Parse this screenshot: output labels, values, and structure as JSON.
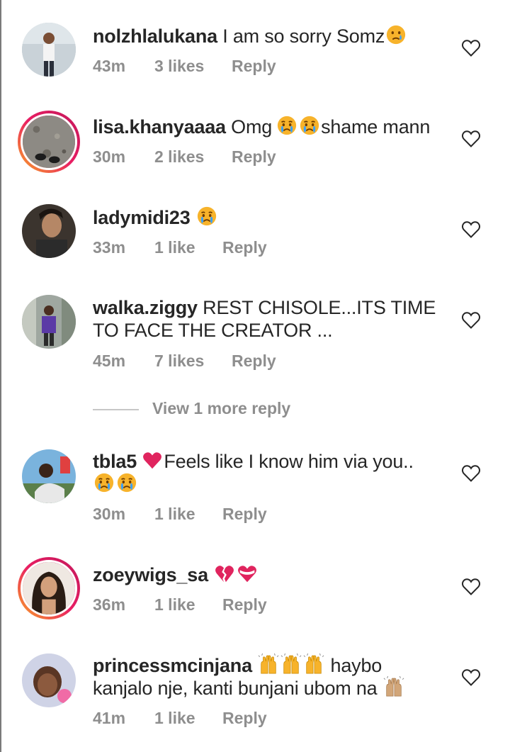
{
  "comments": [
    {
      "username": "nolzhlalukana",
      "text": "I am so sorry Somz",
      "time": "43m",
      "likes": "3 likes",
      "reply": "Reply",
      "story_ring": false
    },
    {
      "username": "lisa.khanyaaaa",
      "text_before": "Omg",
      "text": "shame mann",
      "time": "30m",
      "likes": "2 likes",
      "reply": "Reply",
      "story_ring": true
    },
    {
      "username": "ladymidi23",
      "time": "33m",
      "likes": "1 like",
      "reply": "Reply",
      "story_ring": false
    },
    {
      "username": "walka.ziggy",
      "text_line1": "REST CHISOLE...ITS TIME",
      "text_line2": "TO FACE THE CREATOR ...",
      "time": "45m",
      "likes": "7 likes",
      "reply": "Reply",
      "story_ring": false,
      "view_more": "View 1 more reply"
    },
    {
      "username": "tbla5",
      "text": "Feels like I know him via you..",
      "time": "30m",
      "likes": "1 like",
      "reply": "Reply",
      "story_ring": false
    },
    {
      "username": "zoeywigs_sa",
      "time": "36m",
      "likes": "1 like",
      "reply": "Reply",
      "story_ring": true
    },
    {
      "username": "princessmcinjana",
      "text_line1": "haybo",
      "text_line2": "kanjalo nje, kanti bunjani ubom na",
      "time": "41m",
      "likes": "1 like",
      "reply": "Reply",
      "story_ring": false
    }
  ],
  "icons": {
    "like": "heart-outline-icon",
    "crying": "crying-face-emoji",
    "red_heart": "red-heart-emoji",
    "broken_heart": "broken-heart-emoji",
    "heart_ribbon": "heart-with-ribbon-emoji",
    "raised_hands": "raising-hands-emoji"
  },
  "colors": {
    "text": "#262626",
    "meta": "#8e8e8e",
    "ring_start": "#f9a825",
    "ring_end": "#c2185b",
    "emoji_yellow": "#f7b32b",
    "heart_red": "#e0245e"
  }
}
